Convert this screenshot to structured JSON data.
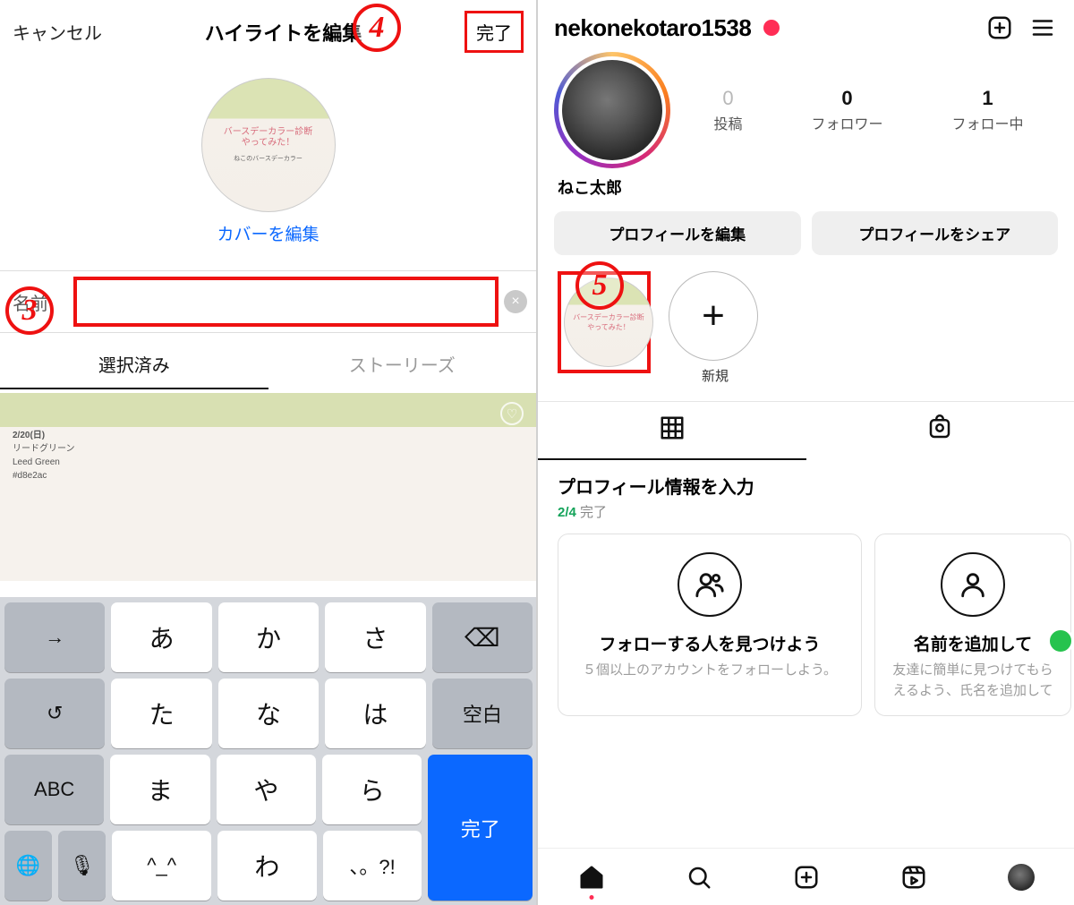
{
  "left": {
    "header": {
      "cancel": "キャンセル",
      "title": "ハイライトを編集",
      "done": "完了"
    },
    "cover": {
      "line1": "バースデーカラー診断",
      "line2": "やってみた！",
      "sub": "ねこのバースデーカラー",
      "edit_label": "カバーを編集"
    },
    "name": {
      "label": "名前",
      "value": "",
      "clear_icon": "×"
    },
    "tabs": {
      "selected": "選択済み",
      "stories": "ストーリーズ"
    },
    "preview": {
      "date": "2/20(日)",
      "l1": "リードグリーン",
      "l2": "Leed Green",
      "l3": "#d8e2ac"
    },
    "keyboard": {
      "row1": [
        "→",
        "あ",
        "か",
        "さ"
      ],
      "back": "⌫",
      "row2": [
        "↺",
        "た",
        "な",
        "は"
      ],
      "space": "空白",
      "row3": [
        "ABC",
        "ま",
        "や",
        "ら"
      ],
      "row4": [
        "^_^",
        "わ",
        "、。?!"
      ],
      "globe": "🌐",
      "mic": "🎙",
      "bottom_done": "完了"
    },
    "annotations": {
      "step3": "3",
      "step4": "4"
    }
  },
  "right": {
    "header": {
      "username": "nekonekotaro1538"
    },
    "stats": {
      "posts_n": "0",
      "posts_l": "投稿",
      "followers_n": "0",
      "followers_l": "フォロワー",
      "following_n": "1",
      "following_l": "フォロー中"
    },
    "display_name": "ねこ太郎",
    "buttons": {
      "edit": "プロフィールを編集",
      "share": "プロフィールをシェア"
    },
    "highlights": {
      "item_line1": "バースデーカラー診断",
      "item_line2": "やってみた！",
      "empty_label": "",
      "new_label": "新規"
    },
    "info": {
      "title": "プロフィール情報を入力",
      "done": "2/4",
      "done_suffix": " 完了"
    },
    "cards": {
      "c1_title": "フォローする人を見つけよう",
      "c1_sub": "５個以上のアカウントをフォローしよう。",
      "c2_title": "名前を追加して",
      "c2_sub": "友達に簡単に見つけてもらえるよう、氏名を追加して"
    },
    "annotations": {
      "step5": "5"
    }
  }
}
